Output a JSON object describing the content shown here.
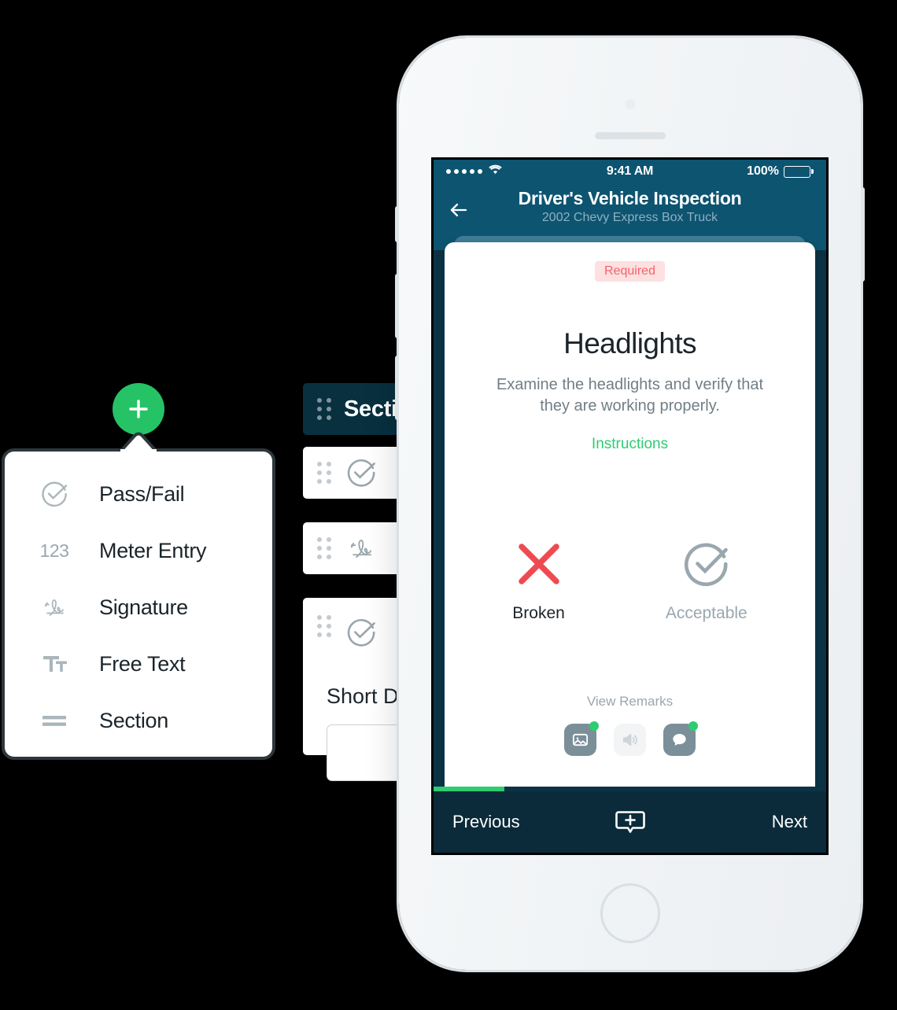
{
  "builder": {
    "section_row_label": "Secti",
    "rows": [
      {
        "type": "section",
        "label": "Secti",
        "icon": "drag-handle-icon"
      },
      {
        "type": "passfail",
        "icon": "check-circle-icon"
      },
      {
        "type": "signature",
        "icon": "signature-icon"
      },
      {
        "type": "passfail",
        "icon": "check-circle-icon"
      }
    ],
    "short_description_label": "Short De",
    "short_description_value": ""
  },
  "phone": {
    "status_bar": {
      "time": "9:41 AM",
      "battery_percent": "100%",
      "signal_dots": 5,
      "wifi_icon": "wifi-icon"
    },
    "nav": {
      "back_icon": "arrow-left-icon",
      "title": "Driver's Vehicle Inspection",
      "subtitle": "2002 Chevy Express Box Truck"
    },
    "card": {
      "required_badge": "Required",
      "title": "Headlights",
      "description": "Examine the headlights and verify that they are working properly.",
      "instructions_link": "Instructions",
      "choices": [
        {
          "label": "Broken",
          "icon": "x-mark-icon",
          "state": "selected"
        },
        {
          "label": "Acceptable",
          "icon": "check-circle-icon",
          "state": "unselected"
        }
      ],
      "remarks_label": "View Remarks",
      "remark_buttons": [
        {
          "icon": "photo-icon",
          "enabled": true,
          "badge": true
        },
        {
          "icon": "audio-icon",
          "enabled": false,
          "badge": false
        },
        {
          "icon": "comment-icon",
          "enabled": true,
          "badge": true
        }
      ]
    },
    "progress_percent": 18,
    "bottom_bar": {
      "previous_label": "Previous",
      "add_icon": "add-comment-icon",
      "next_label": "Next"
    }
  },
  "fab": {
    "icon": "plus-icon"
  },
  "menu": {
    "items": [
      {
        "label": "Pass/Fail",
        "icon": "check-circle-icon"
      },
      {
        "label": "Meter Entry",
        "icon": "123-icon",
        "glyph": "123"
      },
      {
        "label": "Signature",
        "icon": "signature-icon"
      },
      {
        "label": "Free Text",
        "icon": "text-size-icon"
      },
      {
        "label": "Section",
        "icon": "section-lines-icon"
      }
    ]
  },
  "colors": {
    "green": "#25c366",
    "green_light": "#2ecc71",
    "nav_blue": "#0d5471",
    "screen_dark": "#0b3345",
    "bottom_bar": "#0b2b3a",
    "required_bg": "#fde0e0",
    "required_text": "#f4626b",
    "broken_red": "#ef4a52",
    "muted_gray": "#9aa7ae"
  }
}
